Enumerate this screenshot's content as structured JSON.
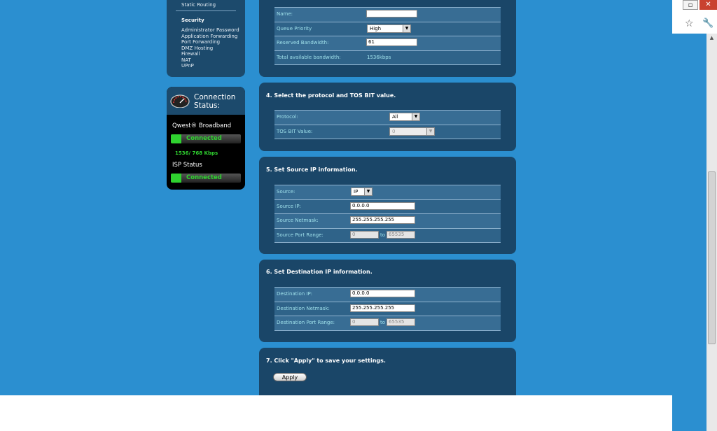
{
  "browser": {
    "restore_glyph": "▫",
    "close_glyph": "✕",
    "star_glyph": "☆",
    "wrench_glyph": "🔧"
  },
  "nav": {
    "top_item": "Static Routing",
    "security_header": "Security",
    "security_items": [
      "Administrator Password",
      "Application Forwarding",
      "Port Forwarding",
      "DMZ Hosting",
      "Firewall",
      "NAT",
      "UPnP"
    ]
  },
  "connection": {
    "title_line1": "Connection",
    "title_line2": "Status:",
    "broadband_label": "Qwest® Broadband",
    "broadband_status": "Connected",
    "speed": "1536/ 768 Kbps",
    "isp_label": "ISP Status",
    "isp_status": "Connected"
  },
  "section3": {
    "rows": {
      "name_label": "Name:",
      "name_value": "",
      "priority_label": "Queue Priority",
      "priority_value": "High",
      "reserved_label": "Reserved Bandwidth:",
      "reserved_value": "61",
      "total_label": "Total available bandwidth:",
      "total_value": "1536kbps"
    }
  },
  "section4": {
    "title": "4. Select the protocol and TOS BIT value.",
    "protocol_label": "Protocol:",
    "protocol_value": "All",
    "tos_label": "TOS BIT Value:",
    "tos_value": "0"
  },
  "section5": {
    "title": "5. Set Source IP information.",
    "source_label": "Source:",
    "source_value": "IP",
    "ip_label": "Source IP:",
    "ip_value": "0.0.0.0",
    "netmask_label": "Source Netmask:",
    "netmask_value": "255.255.255.255",
    "port_label": "Source Port Range:",
    "port_from": "0",
    "to_text": "to",
    "port_to": "65535"
  },
  "section6": {
    "title": "6. Set Destination IP information.",
    "ip_label": "Destination IP:",
    "ip_value": "0.0.0.0",
    "netmask_label": "Destination Netmask:",
    "netmask_value": "255.255.255.255",
    "port_label": "Destination Port Range:",
    "port_from": "0",
    "to_text": "to",
    "port_to": "65535"
  },
  "section7": {
    "title": "7. Click \"Apply\" to save your settings.",
    "apply_label": "Apply"
  }
}
